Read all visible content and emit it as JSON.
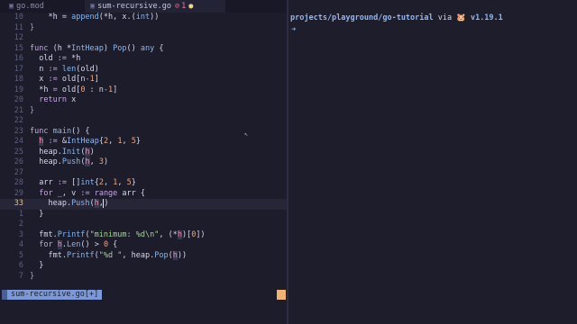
{
  "tabs": [
    {
      "icon": "go-file-icon",
      "label": "go.mod"
    },
    {
      "icon": "go-file-icon",
      "label": "sum-recursive.go",
      "error_icon": "⊘",
      "error_count": "1",
      "modified": "●"
    }
  ],
  "code_lines": [
    {
      "n": "10",
      "t": [
        [
          "    ",
          ""
        ],
        [
          "*h = ",
          ""
        ],
        [
          "append",
          "fn"
        ],
        [
          "(*h, x.(",
          ""
        ],
        [
          "int",
          "ty"
        ],
        [
          "))",
          ""
        ]
      ]
    },
    {
      "n": "11",
      "t": [
        [
          "}",
          "pn"
        ]
      ]
    },
    {
      "n": "12",
      "t": []
    },
    {
      "n": "15",
      "t": [
        [
          "func ",
          "kw"
        ],
        [
          "(h *",
          ""
        ],
        [
          "IntHeap",
          "ty"
        ],
        [
          ") ",
          ""
        ],
        [
          "Pop",
          "fn"
        ],
        [
          "() ",
          ""
        ],
        [
          "any",
          "ty"
        ],
        [
          " {",
          ""
        ]
      ]
    },
    {
      "n": "16",
      "t": [
        [
          "  old ",
          ""
        ],
        [
          ":=",
          "kw"
        ],
        [
          " *h",
          ""
        ]
      ]
    },
    {
      "n": "17",
      "t": [
        [
          "  n ",
          ""
        ],
        [
          ":=",
          "kw"
        ],
        [
          " ",
          ""
        ],
        [
          "len",
          "fn"
        ],
        [
          "(old)",
          ""
        ]
      ]
    },
    {
      "n": "18",
      "t": [
        [
          "  x ",
          ""
        ],
        [
          ":=",
          "kw"
        ],
        [
          " old[n",
          ""
        ],
        [
          "-",
          "kw"
        ],
        [
          "1",
          "num"
        ],
        [
          "]",
          ""
        ]
      ]
    },
    {
      "n": "19",
      "t": [
        [
          "  *h ",
          ""
        ],
        [
          "=",
          "kw"
        ],
        [
          " old[",
          ""
        ],
        [
          "0",
          "num"
        ],
        [
          " : n",
          ""
        ],
        [
          "-",
          "kw"
        ],
        [
          "1",
          "num"
        ],
        [
          "]",
          ""
        ]
      ]
    },
    {
      "n": "20",
      "t": [
        [
          "  ",
          ""
        ],
        [
          "return",
          "kw"
        ],
        [
          " x",
          ""
        ]
      ]
    },
    {
      "n": "21",
      "t": [
        [
          "}",
          "pn"
        ]
      ]
    },
    {
      "n": "22",
      "t": []
    },
    {
      "n": "23",
      "t": [
        [
          "func ",
          "kw"
        ],
        [
          "main",
          "fn"
        ],
        [
          "() {",
          ""
        ]
      ]
    },
    {
      "n": "24",
      "t": [
        [
          "  ",
          ""
        ],
        [
          "h",
          "hlvar"
        ],
        [
          " ",
          ""
        ],
        [
          ":=",
          "kw"
        ],
        [
          " &",
          ""
        ],
        [
          "IntHeap",
          "ty"
        ],
        [
          "{",
          ""
        ],
        [
          "2",
          "num"
        ],
        [
          ", ",
          ""
        ],
        [
          "1",
          "num"
        ],
        [
          ", ",
          ""
        ],
        [
          "5",
          "num"
        ],
        [
          "}",
          ""
        ]
      ]
    },
    {
      "n": "25",
      "t": [
        [
          "  heap.",
          ""
        ],
        [
          "Init",
          "fn"
        ],
        [
          "(",
          ""
        ],
        [
          "h",
          "hlvar"
        ],
        [
          ")",
          ""
        ]
      ]
    },
    {
      "n": "26",
      "t": [
        [
          "  heap.",
          ""
        ],
        [
          "Push",
          "fn"
        ],
        [
          "(",
          ""
        ],
        [
          "h",
          "hlvar"
        ],
        [
          ", ",
          ""
        ],
        [
          "3",
          "num"
        ],
        [
          ")",
          ""
        ]
      ]
    },
    {
      "n": "27",
      "t": []
    },
    {
      "n": "28",
      "t": [
        [
          "  arr ",
          ""
        ],
        [
          ":=",
          "kw"
        ],
        [
          " []",
          ""
        ],
        [
          "int",
          "ty"
        ],
        [
          "{",
          ""
        ],
        [
          "2",
          "num"
        ],
        [
          ", ",
          ""
        ],
        [
          "1",
          "num"
        ],
        [
          ", ",
          ""
        ],
        [
          "5",
          "num"
        ],
        [
          "}",
          ""
        ]
      ]
    },
    {
      "n": "29",
      "t": [
        [
          "  ",
          ""
        ],
        [
          "for",
          "kw"
        ],
        [
          " _, v ",
          ""
        ],
        [
          ":=",
          "kw"
        ],
        [
          " ",
          ""
        ],
        [
          "range",
          "kw"
        ],
        [
          " arr {",
          ""
        ]
      ]
    },
    {
      "n": "33",
      "cur": true,
      "t": [
        [
          "    heap.",
          ""
        ],
        [
          "Push",
          "fn"
        ],
        [
          "(",
          ""
        ],
        [
          "h",
          "hlvar"
        ],
        [
          ",",
          ""
        ],
        [
          "CURSOR",
          "cursor"
        ],
        [
          ")",
          ""
        ]
      ]
    },
    {
      "n": "1",
      "t": [
        [
          "  }",
          ""
        ]
      ]
    },
    {
      "n": "2",
      "t": []
    },
    {
      "n": "3",
      "t": [
        [
          "  fmt.",
          ""
        ],
        [
          "Printf",
          "fn"
        ],
        [
          "(",
          ""
        ],
        [
          "\"minimum: %d\\n\"",
          "str"
        ],
        [
          ", (*",
          ""
        ],
        [
          "h",
          "hlvar"
        ],
        [
          ")[",
          ""
        ],
        [
          "0",
          "num"
        ],
        [
          "])",
          ""
        ]
      ]
    },
    {
      "n": "4",
      "t": [
        [
          "  ",
          ""
        ],
        [
          "for",
          "kw"
        ],
        [
          " ",
          ""
        ],
        [
          "h",
          "hlvar"
        ],
        [
          ".",
          ""
        ],
        [
          "Len",
          "fn"
        ],
        [
          "() > ",
          ""
        ],
        [
          "0",
          "num"
        ],
        [
          " {",
          ""
        ]
      ]
    },
    {
      "n": "5",
      "t": [
        [
          "    fmt.",
          ""
        ],
        [
          "Printf",
          "fn"
        ],
        [
          "(",
          ""
        ],
        [
          "\"%d \"",
          "str"
        ],
        [
          ", heap.",
          ""
        ],
        [
          "Pop",
          "fn"
        ],
        [
          "(",
          ""
        ],
        [
          "h",
          "hlvar"
        ],
        [
          "))",
          ""
        ]
      ]
    },
    {
      "n": "6",
      "t": [
        [
          "  }",
          ""
        ]
      ]
    },
    {
      "n": "7",
      "t": [
        [
          "}",
          "pn"
        ]
      ]
    }
  ],
  "statusline": {
    "file_label": "sum-recursive.go[+]"
  },
  "terminal": {
    "path": "projects/playground/go-tutorial",
    "via": " via ",
    "gopher": "🐹",
    "version": " v1.19.1",
    "arrow": "➜"
  },
  "colors": {
    "accent": "#7b99d8",
    "status_block": "#f0b46f",
    "background": "#1c1c2a"
  }
}
